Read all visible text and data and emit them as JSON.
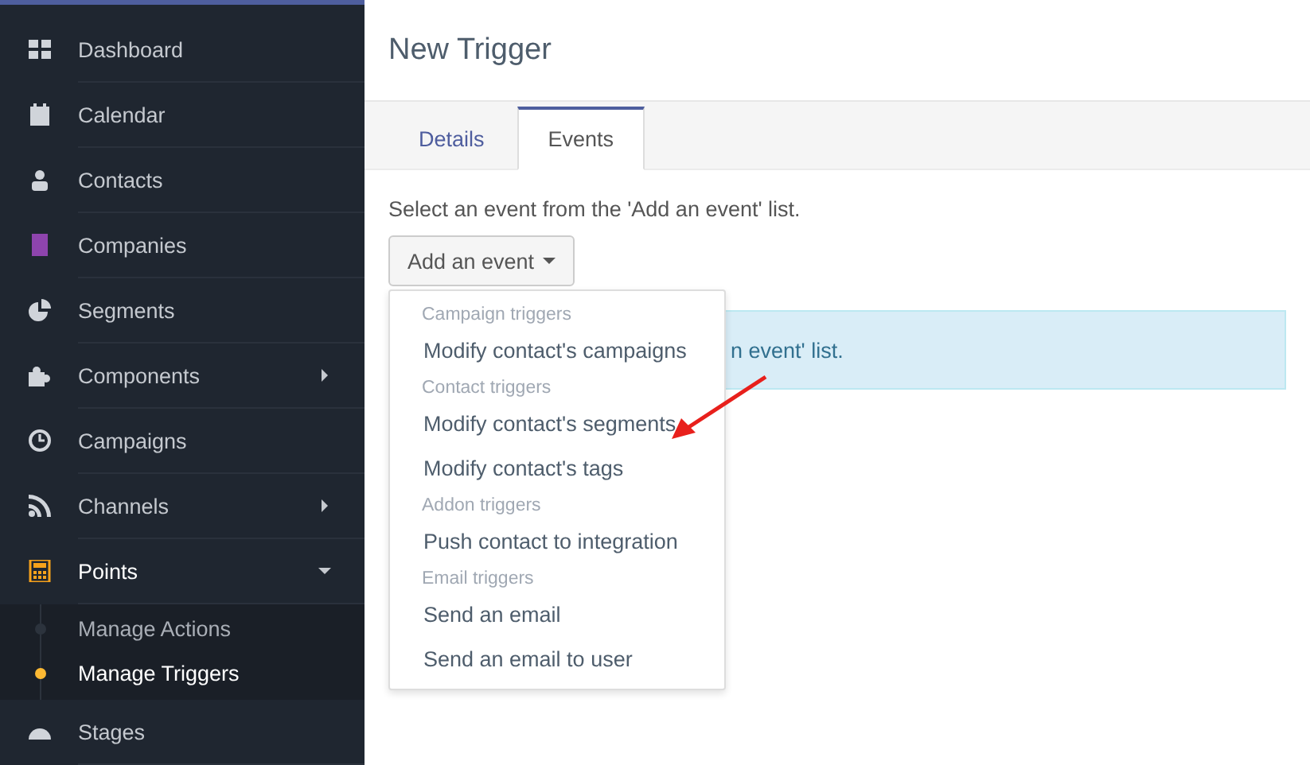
{
  "sidebar": {
    "items": [
      {
        "label": "Dashboard",
        "selected": false
      },
      {
        "label": "Calendar",
        "selected": false
      },
      {
        "label": "Contacts",
        "selected": false
      },
      {
        "label": "Companies",
        "selected": false
      },
      {
        "label": "Segments",
        "selected": false
      },
      {
        "label": "Components",
        "selected": false,
        "expanded": false
      },
      {
        "label": "Campaigns",
        "selected": false
      },
      {
        "label": "Channels",
        "selected": false,
        "expanded": false
      },
      {
        "label": "Points",
        "selected": true,
        "expanded": true,
        "children": [
          {
            "label": "Manage Actions",
            "selected": false
          },
          {
            "label": "Manage Triggers",
            "selected": true
          }
        ]
      },
      {
        "label": "Stages",
        "selected": false
      }
    ]
  },
  "page": {
    "title": "New Trigger"
  },
  "tabs": [
    {
      "label": "Details",
      "selected": false
    },
    {
      "label": "Events",
      "selected": true
    }
  ],
  "instruction": "Select an event from the 'Add an event' list.",
  "add_button": {
    "label": "Add an event"
  },
  "info_box": {
    "text": "n event' list."
  },
  "dropdown": {
    "items": [
      {
        "kind": "header",
        "label": "Campaign triggers"
      },
      {
        "kind": "item",
        "label": "Modify contact's campaigns"
      },
      {
        "kind": "header",
        "label": "Contact triggers"
      },
      {
        "kind": "item",
        "label": "Modify contact's segments"
      },
      {
        "kind": "item",
        "label": "Modify contact's tags"
      },
      {
        "kind": "header",
        "label": "Addon triggers"
      },
      {
        "kind": "item",
        "label": "Push contact to integration"
      },
      {
        "kind": "header",
        "label": "Email triggers"
      },
      {
        "kind": "item",
        "label": "Send an email"
      },
      {
        "kind": "item",
        "label": "Send an email to user"
      }
    ]
  }
}
